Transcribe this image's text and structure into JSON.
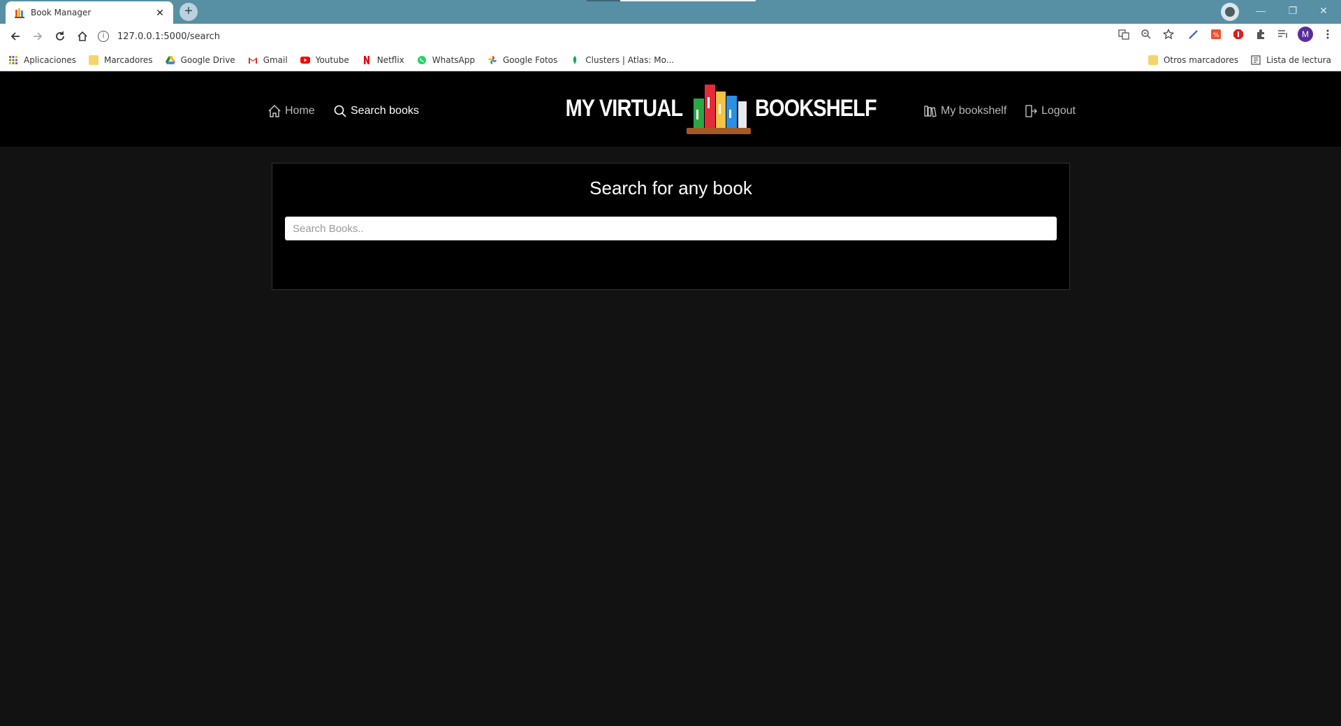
{
  "browser": {
    "tab_title": "Book Manager",
    "url": "127.0.0.1:5000/search",
    "bookmarks": [
      {
        "label": "Aplicaciones",
        "icon": "apps-grid-icon"
      },
      {
        "label": "Marcadores",
        "icon": "folder-icon"
      },
      {
        "label": "Google Drive",
        "icon": "google-drive-icon"
      },
      {
        "label": "Gmail",
        "icon": "gmail-icon"
      },
      {
        "label": "Youtube",
        "icon": "youtube-icon"
      },
      {
        "label": "Netflix",
        "icon": "netflix-icon"
      },
      {
        "label": "WhatsApp",
        "icon": "whatsapp-icon"
      },
      {
        "label": "Google Fotos",
        "icon": "google-photos-icon"
      },
      {
        "label": "Clusters | Atlas: Mo...",
        "icon": "mongodb-leaf-icon"
      }
    ],
    "bookmarks_right": [
      {
        "label": "Otros marcadores",
        "icon": "folder-icon"
      },
      {
        "label": "Lista de lectura",
        "icon": "reading-list-icon"
      }
    ],
    "avatar_letter": "M",
    "colors": {
      "tabstrip": "#578fa4",
      "page_bg": "#121212",
      "header_bg": "#000000"
    }
  },
  "site": {
    "nav": {
      "home": "Home",
      "search": "Search books",
      "bookshelf": "My bookshelf",
      "logout": "Logout"
    },
    "logo": {
      "left": "MY VIRTUAL",
      "right": "BOOKSHELF"
    },
    "search": {
      "title": "Search for any book",
      "placeholder": "Search Books..",
      "value": ""
    }
  }
}
